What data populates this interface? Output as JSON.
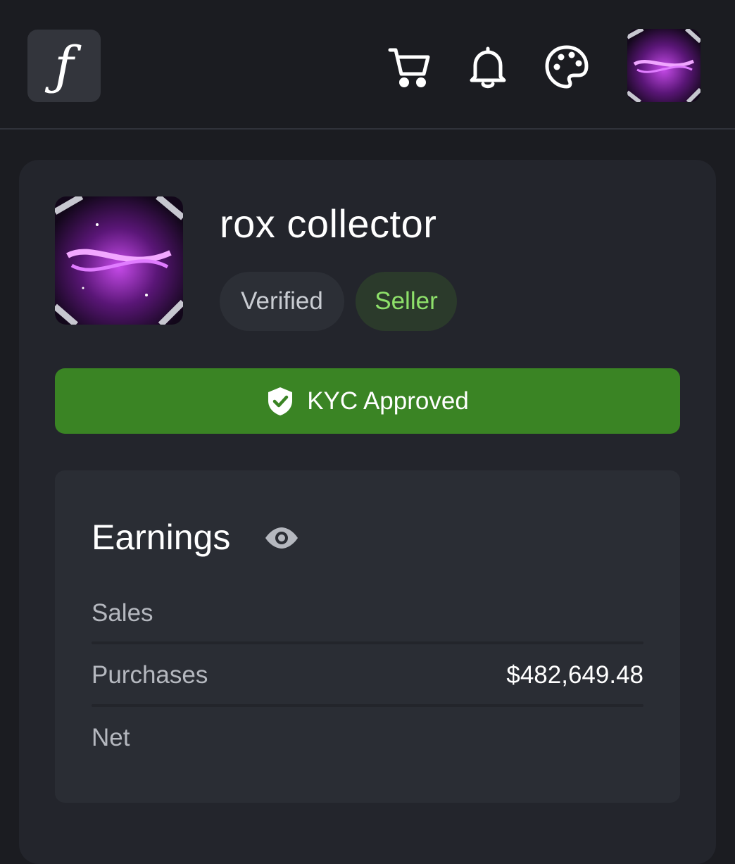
{
  "header": {
    "logo_text": "ƒ",
    "icons": [
      "cart-icon",
      "bell-icon",
      "palette-icon"
    ]
  },
  "profile": {
    "name": "rox collector",
    "badges": {
      "verified": "Verified",
      "seller": "Seller"
    }
  },
  "kyc": {
    "label": "KYC Approved"
  },
  "earnings": {
    "title": "Earnings",
    "rows": [
      {
        "label": "Sales",
        "value": ""
      },
      {
        "label": "Purchases",
        "value": "$482,649.48"
      },
      {
        "label": "Net",
        "value": ""
      }
    ]
  },
  "colors": {
    "background": "#1b1c21",
    "card": "#23252c",
    "kyc_green": "#3a8424",
    "seller_text": "#8ee06a",
    "accent_purple": "#b03ad8"
  }
}
